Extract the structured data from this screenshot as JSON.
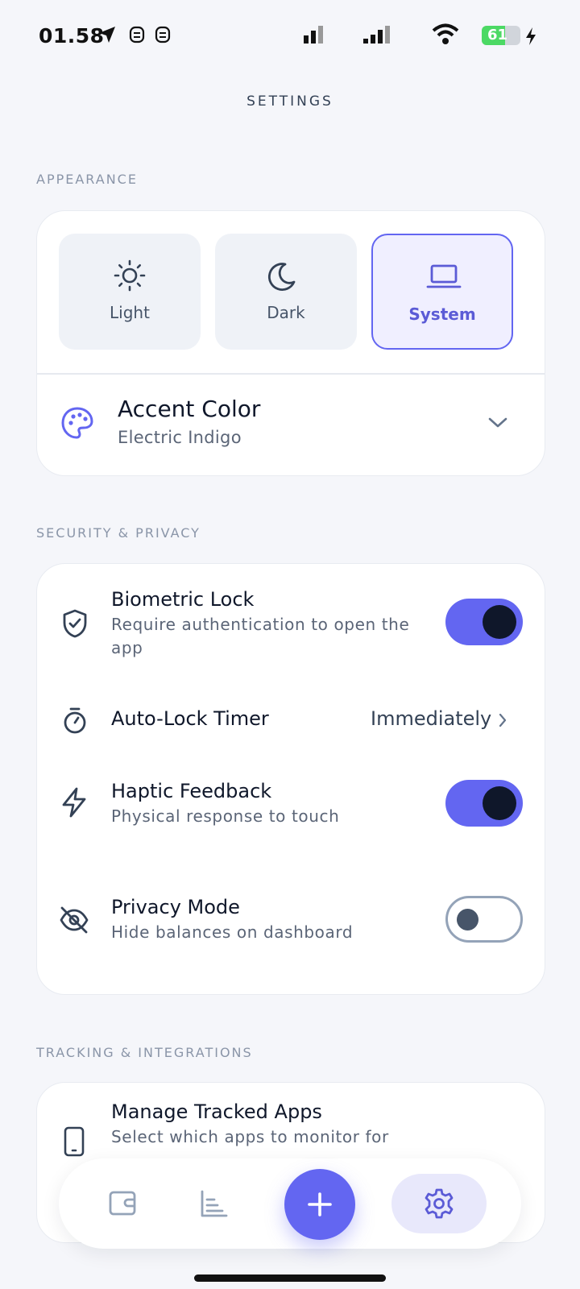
{
  "status_bar": {
    "time": "01.58",
    "battery": "61",
    "battery_level": 0.61
  },
  "header": {
    "title": "SETTINGS"
  },
  "sections": {
    "appearance": {
      "label": "APPEARANCE",
      "themes": [
        {
          "label": "Light",
          "icon": "sun-icon"
        },
        {
          "label": "Dark",
          "icon": "moon-icon"
        },
        {
          "label": "System",
          "icon": "laptop-icon",
          "selected": true
        }
      ],
      "accent": {
        "title": "Accent Color",
        "value": "Electric Indigo",
        "icon": "palette-icon"
      }
    },
    "security": {
      "label": "SECURITY & PRIVACY",
      "biometric": {
        "title": "Biometric Lock",
        "subtitle_line1": "Require authentication to open the",
        "subtitle_line2": "app",
        "on": true
      },
      "autolock": {
        "title": "Auto-Lock Timer",
        "value": "Immediately"
      },
      "haptic": {
        "title": "Haptic Feedback",
        "subtitle": "Physical response to touch",
        "on": true
      },
      "privacy": {
        "title": "Privacy Mode",
        "subtitle": "Hide balances on dashboard",
        "on": false
      }
    },
    "tracking": {
      "label": "TRACKING & INTEGRATIONS",
      "manage": {
        "title": "Manage Tracked Apps",
        "subtitle": "Select which apps to monitor for"
      }
    }
  },
  "nav": [
    "wallet-icon",
    "chart-icon",
    "plus-icon",
    "settings-icon"
  ],
  "colors": {
    "accent": "#6366f1",
    "background": "#f5f6fa",
    "card": "#ffffff"
  }
}
